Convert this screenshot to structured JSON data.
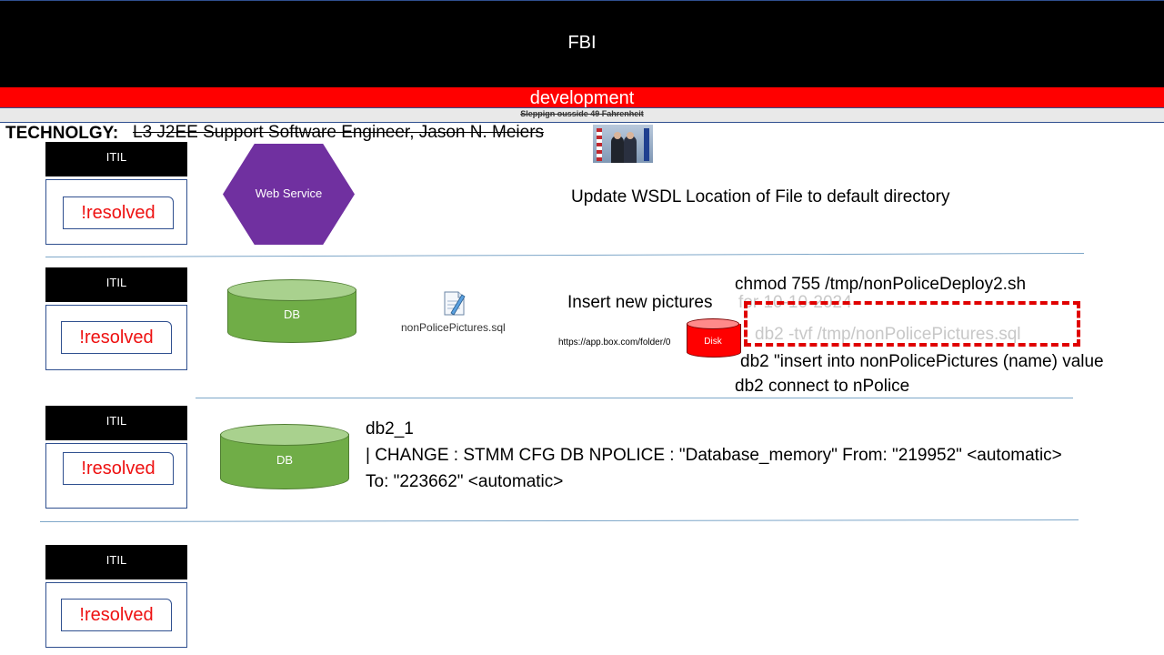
{
  "header": {
    "title": "FBI",
    "subtitle": "development",
    "struck_note": "Sleppign ousside 49 Fahrenheit"
  },
  "technology": {
    "label": "TECHNOLGY:",
    "value": "L3 J2EE Support Software Engineer, Jason N. Meiers"
  },
  "rows": [
    {
      "itil": "ITIL",
      "status": "!resolved"
    },
    {
      "itil": "ITIL",
      "status": "!resolved"
    },
    {
      "itil": "ITIL",
      "status": "!resolved"
    },
    {
      "itil": "ITIL",
      "status": "!resolved"
    }
  ],
  "row1": {
    "shape_label": "Web Service",
    "note": "Update WSDL Location of File to default directory"
  },
  "row2": {
    "db_label": "DB",
    "file_name": "nonPolicePictures.sql",
    "note": "Insert new pictures",
    "note_faded": "for 10-10-2024",
    "url": "https://app.box.com/folder/0",
    "disk_label": "Disk",
    "cmd_chmod": "chmod 755 /tmp/nonPoliceDeploy2.sh",
    "cmd_tvf": "db2 -tvf /tmp/nonPolicePictures.sql",
    "cmd_insert": "db2 \"insert into nonPolicePictures (name) value",
    "cmd_connect": "db2 connect to nPolice"
  },
  "row3": {
    "db_label": "DB",
    "line1": "db2_1",
    "line2": "| CHANGE  : STMM CFG DB NPOLICE : \"Database_memory\" From: \"219952\" <automatic>",
    "line3": "To: \"223662\" <automatic>"
  },
  "colors": {
    "header": "#000000",
    "banner": "#ff0000",
    "hexagon": "#7030a0",
    "db": "#70ad47",
    "disk": "#ff0000",
    "resolved_text": "#ee1111"
  }
}
